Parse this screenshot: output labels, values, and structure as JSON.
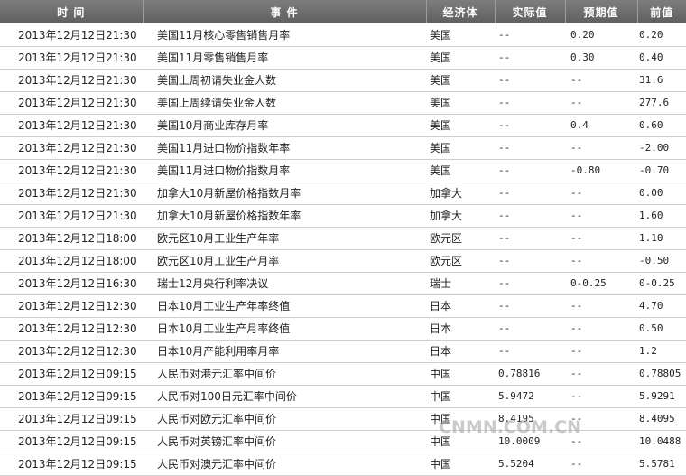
{
  "table": {
    "headers": [
      "时  间",
      "事  件",
      "经济体",
      "实际值",
      "预期值",
      "前值"
    ],
    "rows": [
      {
        "time": "2013年12月12日21:30",
        "event": "美国11月核心零售销售月率",
        "economy": "美国",
        "actual": "--",
        "expected": "0.20",
        "previous": "0.20"
      },
      {
        "time": "2013年12月12日21:30",
        "event": "美国11月零售销售月率",
        "economy": "美国",
        "actual": "--",
        "expected": "0.30",
        "previous": "0.40"
      },
      {
        "time": "2013年12月12日21:30",
        "event": "美国上周初请失业金人数",
        "economy": "美国",
        "actual": "--",
        "expected": "--",
        "previous": "31.6"
      },
      {
        "time": "2013年12月12日21:30",
        "event": "美国上周续请失业金人数",
        "economy": "美国",
        "actual": "--",
        "expected": "--",
        "previous": "277.6"
      },
      {
        "time": "2013年12月12日21:30",
        "event": "美国10月商业库存月率",
        "economy": "美国",
        "actual": "--",
        "expected": "0.4",
        "previous": "0.60"
      },
      {
        "time": "2013年12月12日21:30",
        "event": "美国11月进口物价指数年率",
        "economy": "美国",
        "actual": "--",
        "expected": "--",
        "previous": "-2.00"
      },
      {
        "time": "2013年12月12日21:30",
        "event": "美国11月进口物价指数月率",
        "economy": "美国",
        "actual": "--",
        "expected": "-0.80",
        "previous": "-0.70"
      },
      {
        "time": "2013年12月12日21:30",
        "event": "加拿大10月新屋价格指数月率",
        "economy": "加拿大",
        "actual": "--",
        "expected": "--",
        "previous": "0.00"
      },
      {
        "time": "2013年12月12日21:30",
        "event": "加拿大10月新屋价格指数年率",
        "economy": "加拿大",
        "actual": "--",
        "expected": "--",
        "previous": "1.60"
      },
      {
        "time": "2013年12月12日18:00",
        "event": "欧元区10月工业生产年率",
        "economy": "欧元区",
        "actual": "--",
        "expected": "--",
        "previous": "1.10"
      },
      {
        "time": "2013年12月12日18:00",
        "event": "欧元区10月工业生产月率",
        "economy": "欧元区",
        "actual": "--",
        "expected": "--",
        "previous": "-0.50"
      },
      {
        "time": "2013年12月12日16:30",
        "event": "瑞士12月央行利率决议",
        "economy": "瑞士",
        "actual": "--",
        "expected": "0-0.25",
        "previous": "0-0.25"
      },
      {
        "time": "2013年12月12日12:30",
        "event": "日本10月工业生产年率终值",
        "economy": "日本",
        "actual": "--",
        "expected": "--",
        "previous": "4.70"
      },
      {
        "time": "2013年12月12日12:30",
        "event": "日本10月工业生产月率终值",
        "economy": "日本",
        "actual": "--",
        "expected": "--",
        "previous": "0.50"
      },
      {
        "time": "2013年12月12日12:30",
        "event": "日本10月产能利用率月率",
        "economy": "日本",
        "actual": "--",
        "expected": "--",
        "previous": "1.2"
      },
      {
        "time": "2013年12月12日09:15",
        "event": "人民币对港元汇率中间价",
        "economy": "中国",
        "actual": "0.78816",
        "expected": "--",
        "previous": "0.78805"
      },
      {
        "time": "2013年12月12日09:15",
        "event": "人民币对100日元汇率中间价",
        "economy": "中国",
        "actual": "5.9472",
        "expected": "--",
        "previous": "5.9291"
      },
      {
        "time": "2013年12月12日09:15",
        "event": "人民币对欧元汇率中间价",
        "economy": "中国",
        "actual": "8.4195",
        "expected": "--",
        "previous": "8.4095"
      },
      {
        "time": "2013年12月12日09:15",
        "event": "人民币对英镑汇率中间价",
        "economy": "中国",
        "actual": "10.0009",
        "expected": "--",
        "previous": "10.0488"
      },
      {
        "time": "2013年12月12日09:15",
        "event": "人民币对澳元汇率中间价",
        "economy": "中国",
        "actual": "5.5204",
        "expected": "--",
        "previous": "5.5781"
      }
    ]
  },
  "watermark": "CNMN.COM.CN",
  "colors": {
    "header_bg": "#6e6e6e",
    "header_text": "#ffffff",
    "row_border": "#cfcfcf"
  }
}
